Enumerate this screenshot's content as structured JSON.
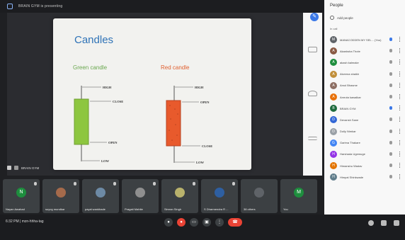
{
  "present_bar": {
    "text": "BRAIN GYM is presenting"
  },
  "slide": {
    "title": "Candles",
    "green_label": "Green candle",
    "red_label": "Red candle",
    "green_marks": {
      "high": "HIGH",
      "close": "CLOSE",
      "open": "OPEN",
      "low": "LOW"
    },
    "red_marks": {
      "high": "HIGH",
      "open": "OPEN",
      "close": "CLOSE",
      "low": "LOW"
    }
  },
  "presenter": {
    "name": "BRAIN GYM"
  },
  "tiles": [
    {
      "name": "Nayan Awahad",
      "initial": "N",
      "color": "#1e8e3e"
    },
    {
      "name": "suyog mundkar",
      "initial": "",
      "color": "#a56a4b"
    },
    {
      "name": "payal wankhade",
      "initial": "",
      "color": "#6d8aa5"
    },
    {
      "name": "Pragati Mahite",
      "initial": "",
      "color": "#8f8f8f"
    },
    {
      "name": "Simran Singh",
      "initial": "",
      "color": "#b9b26c"
    },
    {
      "name": "S Dharmendra R ...",
      "initial": "",
      "color": "#2e5fa1"
    },
    {
      "name": "38 others",
      "initial": "",
      "color": "#5f6368"
    },
    {
      "name": "You",
      "initial": "M",
      "color": "#1e8e3e"
    }
  ],
  "bottom": {
    "meeting": "6:32 PM | mzn-hhha-tag"
  },
  "people": {
    "title": "People",
    "add": "Add people",
    "in_call": "In call",
    "list": [
      {
        "name": "MANACODDEN MY SEL... (You)",
        "initial": "M",
        "color": "#5f6368"
      },
      {
        "name": "Akanksha Thote",
        "initial": "A",
        "color": "#8a5a44"
      },
      {
        "name": "akash kalmake",
        "initial": "A",
        "color": "#1e8e3e"
      },
      {
        "name": "Alveena shaikh",
        "initial": "A",
        "color": "#c18f3a"
      },
      {
        "name": "Amol Bhasme",
        "initial": "A",
        "color": "#8d6e63"
      },
      {
        "name": "Amruta kawalkar",
        "initial": "A",
        "color": "#e8710a"
      },
      {
        "name": "BRAIN GYM",
        "initial": "B",
        "color": "#1e6b3e"
      },
      {
        "name": "Devansh Sane",
        "initial": "D",
        "color": "#3367d6"
      },
      {
        "name": "Dolly Nimkar",
        "initial": "D",
        "color": "#9aa0a6"
      },
      {
        "name": "Garima Thakare",
        "initial": "G",
        "color": "#4285f4"
      },
      {
        "name": "Harshada Ugemuge",
        "initial": "H",
        "color": "#9334e6"
      },
      {
        "name": "Himanshu Wadav",
        "initial": "H",
        "color": "#e37400"
      },
      {
        "name": "Himpal Shinkwade",
        "initial": "H",
        "color": "#607d8b"
      }
    ]
  }
}
